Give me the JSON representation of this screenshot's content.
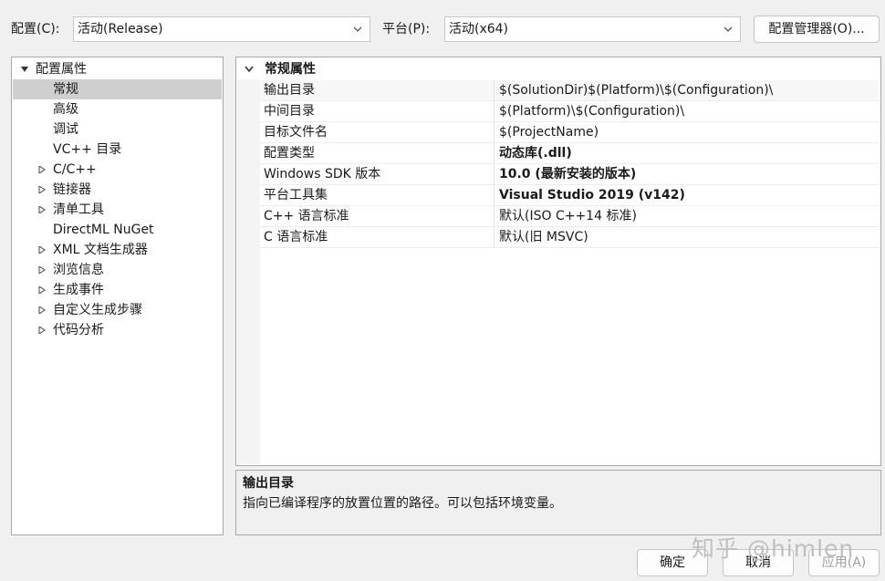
{
  "toolbar": {
    "config_label": "配置(C):",
    "config_value": "活动(Release)",
    "platform_label": "平台(P):",
    "platform_value": "活动(x64)",
    "config_manager_button": "配置管理器(O)..."
  },
  "tree": {
    "root": "配置属性",
    "items": [
      {
        "label": "常规",
        "selected": true,
        "expandable": false
      },
      {
        "label": "高级",
        "expandable": false
      },
      {
        "label": "调试",
        "expandable": false
      },
      {
        "label": "VC++ 目录",
        "expandable": false
      },
      {
        "label": "C/C++",
        "expandable": true
      },
      {
        "label": "链接器",
        "expandable": true
      },
      {
        "label": "清单工具",
        "expandable": true
      },
      {
        "label": "DirectML NuGet",
        "expandable": false
      },
      {
        "label": "XML 文档生成器",
        "expandable": true
      },
      {
        "label": "浏览信息",
        "expandable": true
      },
      {
        "label": "生成事件",
        "expandable": true
      },
      {
        "label": "自定义生成步骤",
        "expandable": true
      },
      {
        "label": "代码分析",
        "expandable": true
      }
    ]
  },
  "grid": {
    "section": "常规属性",
    "rows": [
      {
        "key": "输出目录",
        "value": "$(SolutionDir)$(Platform)\\$(Configuration)\\",
        "bold": false
      },
      {
        "key": "中间目录",
        "value": "$(Platform)\\$(Configuration)\\",
        "bold": false
      },
      {
        "key": "目标文件名",
        "value": "$(ProjectName)",
        "bold": false
      },
      {
        "key": "配置类型",
        "value": "动态库(.dll)",
        "bold": true
      },
      {
        "key": "Windows SDK 版本",
        "value": "10.0 (最新安装的版本)",
        "bold": true
      },
      {
        "key": "平台工具集",
        "value": "Visual Studio 2019 (v142)",
        "bold": true
      },
      {
        "key": "C++ 语言标准",
        "value": "默认(ISO C++14 标准)",
        "bold": false
      },
      {
        "key": "C 语言标准",
        "value": "默认(旧 MSVC)",
        "bold": false
      }
    ]
  },
  "description": {
    "title": "输出目录",
    "text": "指向已编译程序的放置位置的路径。可以包括环境变量。"
  },
  "buttons": {
    "ok": "确定",
    "cancel": "取消",
    "apply": "应用(A)"
  },
  "watermark": "知乎 @himlen",
  "colors": {
    "selection": "#cfcfcf",
    "background": "#f0f0f0"
  }
}
